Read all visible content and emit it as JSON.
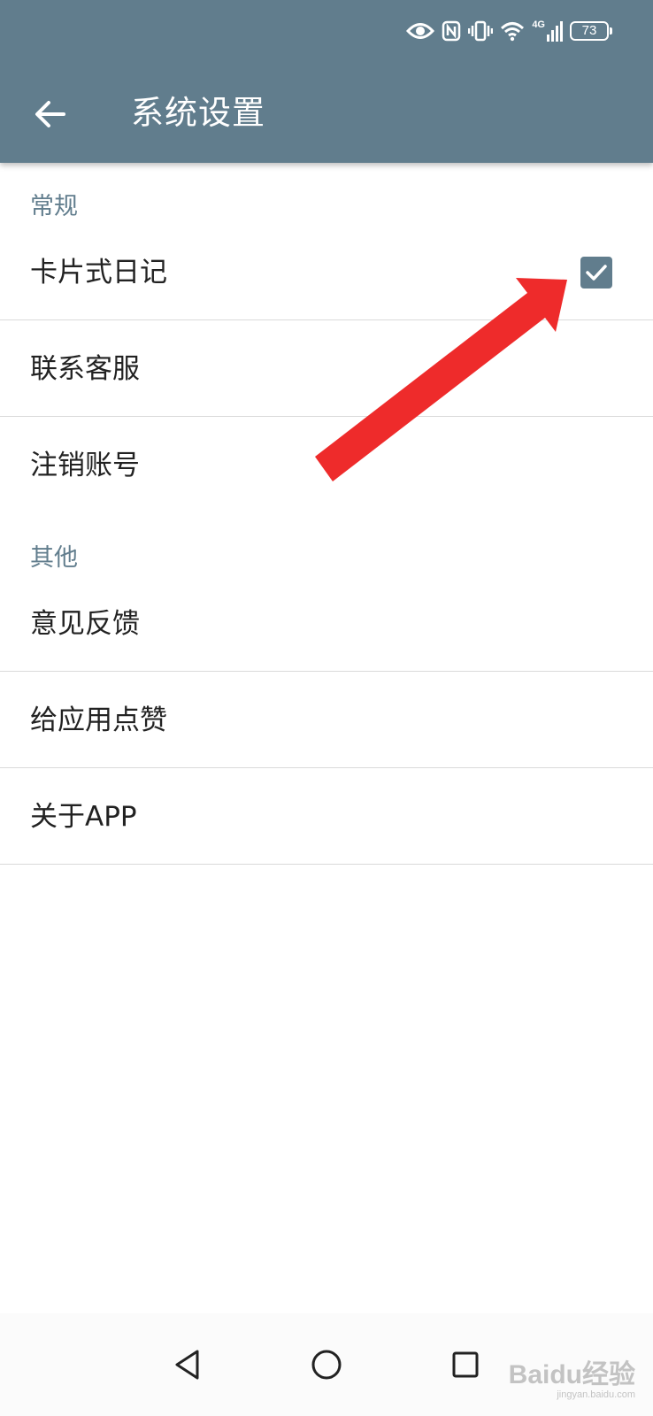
{
  "status_bar": {
    "icons": [
      "eye-icon",
      "nfc-icon",
      "vibrate-icon",
      "wifi-icon",
      "signal-4g-icon"
    ],
    "network_label": "4G",
    "battery_level": "73"
  },
  "header": {
    "back_icon": "back-arrow-icon",
    "title": "系统设置"
  },
  "sections": [
    {
      "title": "常规",
      "items": [
        {
          "label": "卡片式日记",
          "control": "checkbox",
          "checked": true
        },
        {
          "label": "联系客服"
        },
        {
          "label": "注销账号"
        }
      ]
    },
    {
      "title": "其他",
      "items": [
        {
          "label": "意见反馈"
        },
        {
          "label": "给应用点赞"
        },
        {
          "label": "关于APP"
        }
      ]
    }
  ],
  "annotation": {
    "type": "arrow",
    "color": "#ee2b2b",
    "points_to": "卡片式日记 checkbox"
  },
  "nav_bar": {
    "buttons": [
      "nav-back-icon",
      "nav-home-icon",
      "nav-recents-icon"
    ]
  },
  "watermark": {
    "main": "Baidu经验",
    "sub": "jingyan.baidu.com"
  },
  "colors": {
    "app_bar": "#617d8d",
    "section_header": "#617d8d",
    "checkbox": "#617d8d",
    "divider": "#dadada"
  }
}
